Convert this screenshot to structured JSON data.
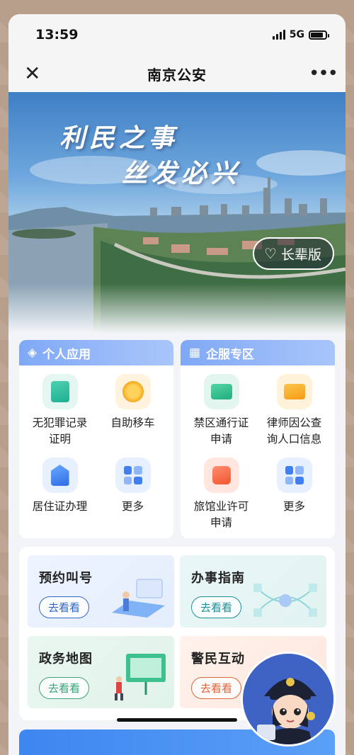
{
  "status": {
    "time": "13:59",
    "network": "5G",
    "battery_level": 0.85
  },
  "nav": {
    "title": "南京公安",
    "close_icon": "close-icon",
    "more_icon": "more-icon"
  },
  "banner": {
    "slogan_line1": "利民之事",
    "slogan_line2": "丝发必兴",
    "elder_mode_label": "长辈版"
  },
  "personal": {
    "title": "个人应用",
    "apps": [
      {
        "label": "无犯罪记录证明",
        "icon": "document-icon"
      },
      {
        "label": "自助移车",
        "icon": "car-icon"
      },
      {
        "label": "居住证办理",
        "icon": "house-icon"
      },
      {
        "label": "更多",
        "icon": "grid-icon"
      }
    ]
  },
  "enterprise": {
    "title": "企服专区",
    "apps": [
      {
        "label": "禁区通行证申请",
        "icon": "pass-card-icon"
      },
      {
        "label": "律师因公查询人口信息",
        "icon": "id-card-icon"
      },
      {
        "label": "旅馆业许可申请",
        "icon": "lock-license-icon"
      },
      {
        "label": "更多",
        "icon": "grid-icon"
      }
    ]
  },
  "services": [
    {
      "title": "预约叫号",
      "button": "去看看",
      "color": "#2f66c8"
    },
    {
      "title": "办事指南",
      "button": "去看看",
      "color": "#1a8f9a"
    },
    {
      "title": "政务地图",
      "button": "去看看",
      "color": "#3aa476"
    },
    {
      "title": "警民互动",
      "button": "去看看",
      "color": "#e0633a"
    }
  ]
}
